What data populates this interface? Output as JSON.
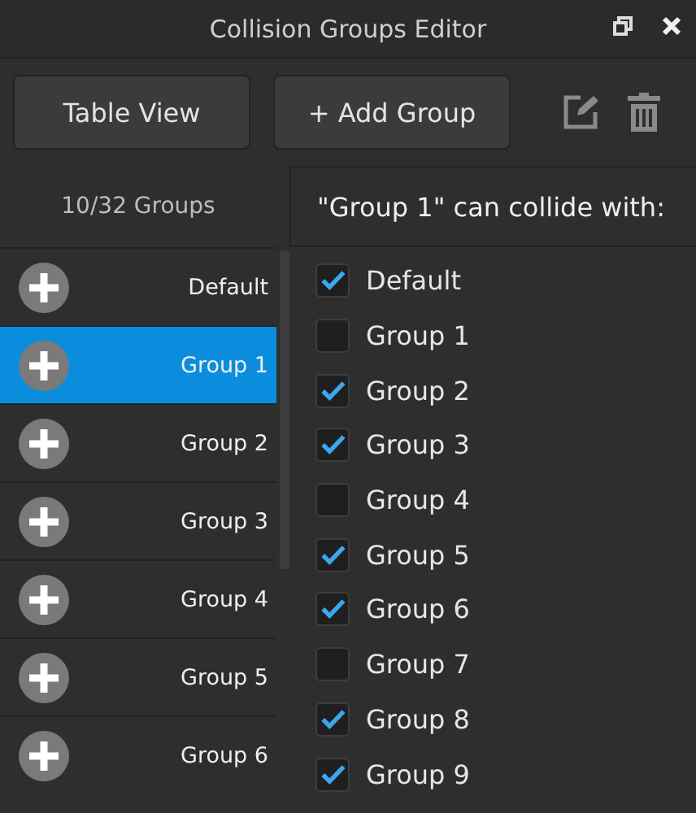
{
  "window": {
    "title": "Collision Groups Editor"
  },
  "toolbar": {
    "buttons": [
      "Table View",
      "+ Add Group"
    ]
  },
  "group_count": "10/32 Groups",
  "groups": [
    {
      "label": "Default",
      "selected": false
    },
    {
      "label": "Group 1",
      "selected": true
    },
    {
      "label": "Group 2",
      "selected": false
    },
    {
      "label": "Group 3",
      "selected": false
    },
    {
      "label": "Group 4",
      "selected": false
    },
    {
      "label": "Group 5",
      "selected": false
    },
    {
      "label": "Group 6",
      "selected": false
    }
  ],
  "collides_heading": "\"Group 1\" can collide with:",
  "collides": [
    {
      "label": "Default",
      "checked": true
    },
    {
      "label": "Group 1",
      "checked": false
    },
    {
      "label": "Group 2",
      "checked": true
    },
    {
      "label": "Group 3",
      "checked": true
    },
    {
      "label": "Group 4",
      "checked": false
    },
    {
      "label": "Group 5",
      "checked": true
    },
    {
      "label": "Group 6",
      "checked": true
    },
    {
      "label": "Group 7",
      "checked": false
    },
    {
      "label": "Group 8",
      "checked": true
    },
    {
      "label": "Group 9",
      "checked": true
    }
  ]
}
